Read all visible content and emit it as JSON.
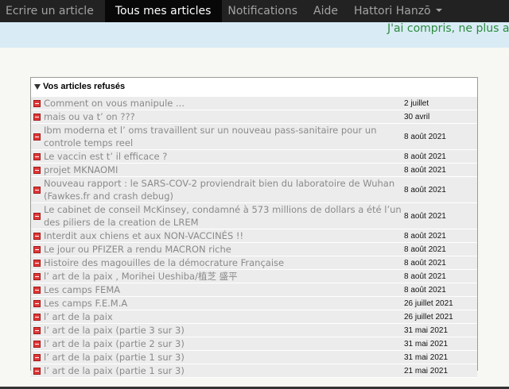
{
  "nav": {
    "items": [
      {
        "label": "Ecrire un article",
        "active": false
      },
      {
        "label": "Tous mes articles",
        "active": true
      },
      {
        "label": "Notifications",
        "active": false
      },
      {
        "label": "Aide",
        "active": false
      },
      {
        "label": "Hattori Hanzō",
        "active": false,
        "dropdown": true
      }
    ]
  },
  "banner": {
    "dismiss_label": "J'ai compris, ne plus afficher ce message"
  },
  "rejected": {
    "title": "Vos articles refusés",
    "items": [
      {
        "title": "Comment on vous manipule ...",
        "date": "2 juillet"
      },
      {
        "title": "mais ou va t’ on ???",
        "date": "30 avril"
      },
      {
        "title": "Ibm moderna et l’ oms travaillent sur un nouveau pass-sanitaire pour un controle temps reel",
        "date": "8 août 2021"
      },
      {
        "title": "Le vaccin est t’ il efficace ?",
        "date": "8 août 2021"
      },
      {
        "title": "projet MKNAOMI",
        "date": "8 août 2021"
      },
      {
        "title": "Nouveau rapport : le SARS-COV-2 proviendrait bien du laboratoire de Wuhan (Fawkes.fr and crash debug)",
        "date": "8 août 2021"
      },
      {
        "title": "Le cabinet de conseil McKinsey, condamné à 573 millions de dollars a été l’un des piliers de la creation de LREM",
        "date": "8 août 2021"
      },
      {
        "title": "Interdit aux chiens et aux NON-VACCINÉS !!",
        "date": "8 août 2021"
      },
      {
        "title": "Le jour ou PFIZER a rendu MACRON riche",
        "date": "8 août 2021"
      },
      {
        "title": "Histoire des magouilles de la démocrature Française",
        "date": "8 août 2021"
      },
      {
        "title": "l’ art de la paix , Morihei Ueshiba/植芝 盛平",
        "date": "8 août 2021"
      },
      {
        "title": "Les camps FEMA",
        "date": "8 août 2021"
      },
      {
        "title": "Les camps F.E.M.A",
        "date": "26 juillet 2021"
      },
      {
        "title": "l’ art de la paix",
        "date": "26 juillet 2021"
      },
      {
        "title": "l’ art de la paix (partie 3 sur 3)",
        "date": "31 mai 2021"
      },
      {
        "title": "l’ art de la paix (partie 2 sur 3)",
        "date": "31 mai 2021"
      },
      {
        "title": "l’ art de la paix (partie 1 sur 3)",
        "date": "31 mai 2021"
      },
      {
        "title": "l’ art de la paix (partie 1 sur 3)",
        "date": "21 mai 2021"
      }
    ]
  }
}
